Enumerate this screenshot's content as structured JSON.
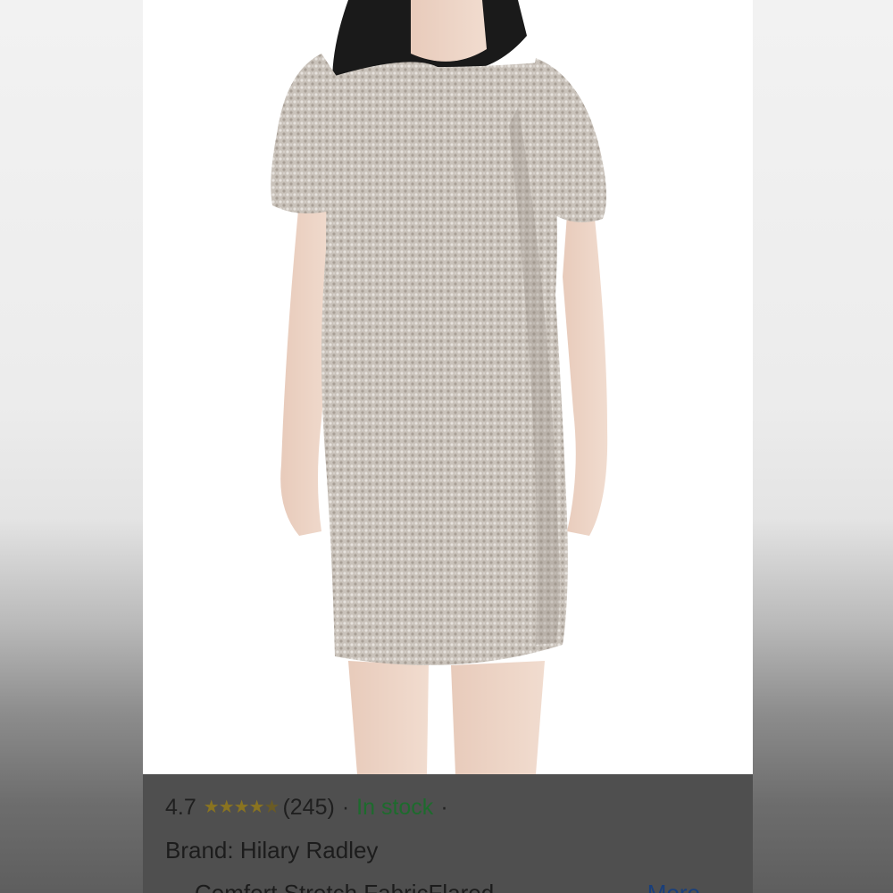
{
  "product_image": {
    "alt": "Silver sequin flutter-sleeve sheath dress on model",
    "dress_color": "#c8c0b8"
  },
  "listing": {
    "rating": "4.7",
    "star_rating_value": 4.7,
    "review_count": "(245)",
    "separator": "·",
    "availability": "In stock",
    "brand_label": "Brand: Hilary Radley",
    "feature_text": "Comfort Stretch FabricFlared",
    "more_link": "More ⌄"
  },
  "colors": {
    "panel_bg": "#4f4f4f",
    "stock_green": "#1d6b2d",
    "star_gold": "#8a7420",
    "link_blue": "#1a3f7a"
  }
}
